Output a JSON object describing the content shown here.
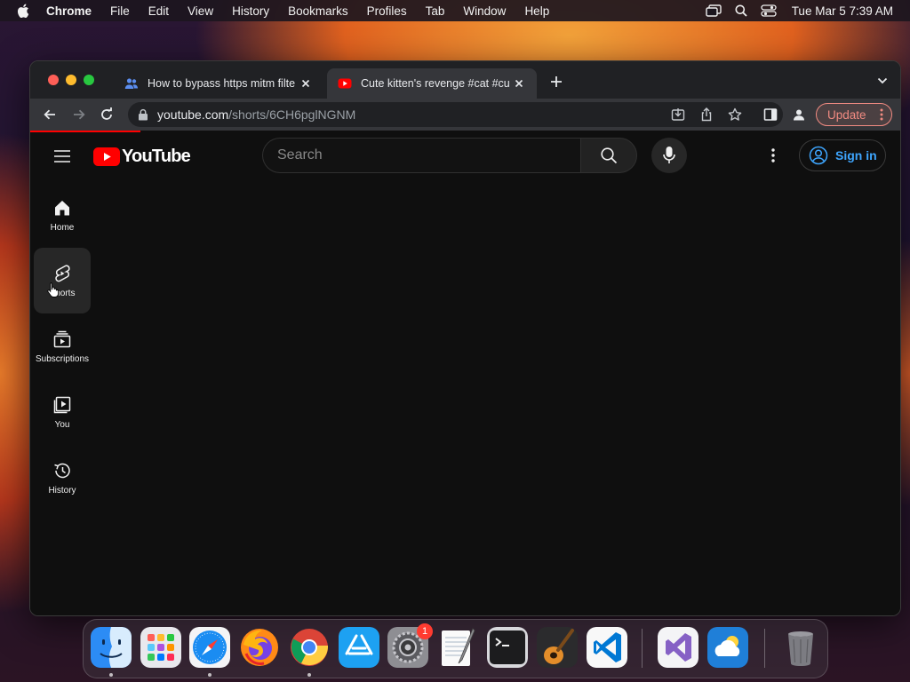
{
  "menubar": {
    "app_name": "Chrome",
    "items": [
      "File",
      "Edit",
      "View",
      "History",
      "Bookmarks",
      "Profiles",
      "Tab",
      "Window",
      "Help"
    ],
    "clock": "Tue Mar 5  7:39 AM"
  },
  "browser": {
    "tabs": [
      {
        "title": "How to bypass https mitm filte",
        "favicon": "people-icon",
        "active": false
      },
      {
        "title": "Cute kitten's revenge #cat #cu",
        "favicon": "youtube-icon",
        "active": true
      }
    ],
    "address": {
      "host": "youtube.com",
      "path": "/shorts/6CH6pglNGNM"
    },
    "update_label": "Update"
  },
  "youtube": {
    "logo_text": "YouTube",
    "search": {
      "placeholder": "Search"
    },
    "signin_label": "Sign in",
    "guide": [
      {
        "label": "Home",
        "icon": "home-icon",
        "active": false
      },
      {
        "label": "Shorts",
        "icon": "shorts-icon",
        "active": true
      },
      {
        "label": "Subscriptions",
        "icon": "subscriptions-icon",
        "active": false
      },
      {
        "label": "You",
        "icon": "you-icon",
        "active": false
      },
      {
        "label": "History",
        "icon": "history-icon",
        "active": false
      }
    ],
    "colors": {
      "brand_red": "#ff0000",
      "link_blue": "#3ea6ff",
      "background": "#0f0f0f"
    }
  },
  "dock": {
    "apps": [
      "Finder",
      "Launchpad",
      "Safari",
      "Firefox",
      "Google Chrome",
      "App Store",
      "System Preferences",
      "TextEdit",
      "Terminal",
      "GarageBand",
      "Visual Studio Code",
      "Visual Studio",
      "Weather",
      "Trash"
    ],
    "system_preferences_badge": "1"
  }
}
